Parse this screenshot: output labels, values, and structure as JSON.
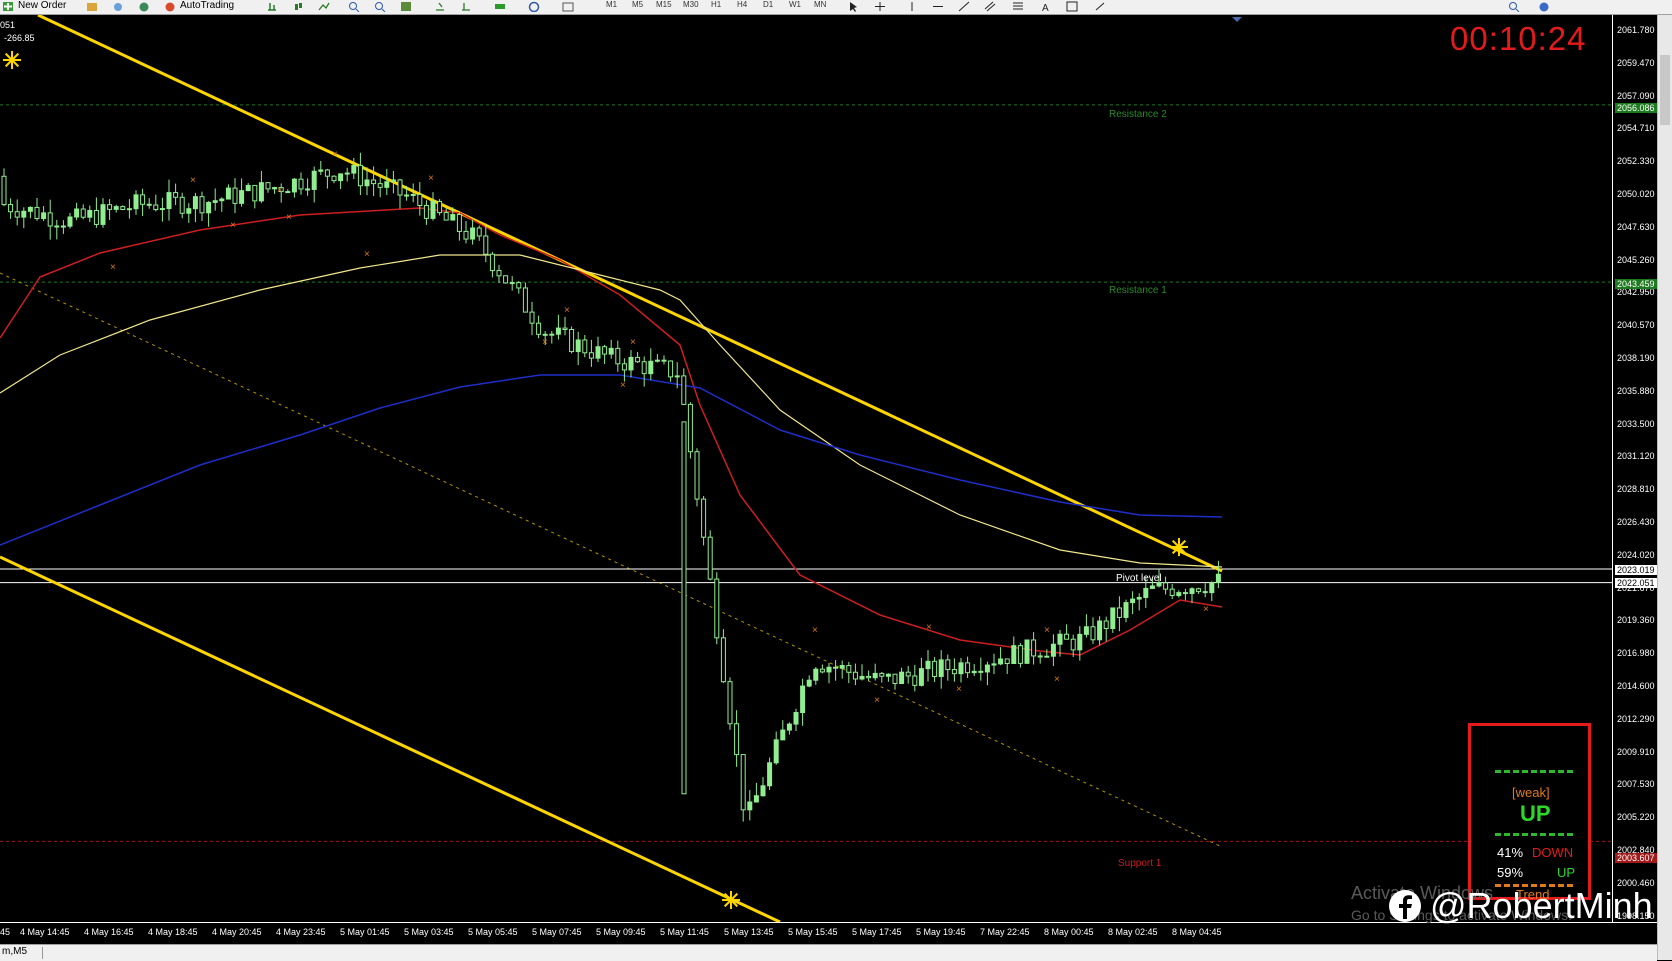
{
  "toolbar": {
    "new_order": "New Order",
    "autotrading": "AutoTrading",
    "timeframes": [
      "M1",
      "M5",
      "M15",
      "M30",
      "H1",
      "H4",
      "D1",
      "W1",
      "MN"
    ]
  },
  "chart_info": {
    "symbol_fragment": "051",
    "value_fragment": "-266.85",
    "timer": "00:10:24"
  },
  "price_axis": {
    "ticks": [
      "2061.780",
      "2059.470",
      "2057.090",
      "2054.710",
      "2052.330",
      "2050.020",
      "2047.630",
      "2045.260",
      "2042.950",
      "2040.570",
      "2038.190",
      "2035.880",
      "2033.500",
      "2031.120",
      "2028.810",
      "2026.430",
      "2024.020",
      "2021.670",
      "2019.360",
      "2016.980",
      "2014.600",
      "2012.290",
      "2009.910",
      "2007.530",
      "2005.220",
      "2002.840",
      "2000.460",
      "1998.150"
    ],
    "badges": {
      "resistance2": "2056.086",
      "resistance1": "2043.459",
      "current1": "2023.019",
      "current2": "2022.051",
      "support1": "2003.607"
    }
  },
  "levels": {
    "resistance2": "Resistance 2",
    "resistance1": "Resistance 1",
    "pivot": "Pivot level",
    "support1": "Support 1"
  },
  "time_axis": {
    "labels": [
      "45",
      "4 May 14:45",
      "4 May 16:45",
      "4 May 18:45",
      "4 May 20:45",
      "4 May 23:45",
      "5 May 01:45",
      "5 May 03:45",
      "5 May 05:45",
      "5 May 07:45",
      "5 May 09:45",
      "5 May 11:45",
      "5 May 13:45",
      "5 May 15:45",
      "5 May 17:45",
      "5 May 19:45",
      "7 May 22:45",
      "8 May 00:45",
      "8 May 02:45",
      "8 May 04:45"
    ]
  },
  "status_bar": {
    "tab": "m,M5"
  },
  "panel": {
    "strength": "[weak]",
    "direction": "UP",
    "down_pct": "41%",
    "down_label": "DOWN",
    "up_pct": "59%",
    "up_label": "UP",
    "trend": "Trend"
  },
  "watermark": {
    "line1": "Activate Windows",
    "line2": "Go to Settings to activate Windows.",
    "social": "@RobertMinh"
  },
  "colors": {
    "bull": "#90ee90",
    "trendline": "#ffd500",
    "ma_red": "#cc1f1f",
    "ma_khaki": "#f0e68c",
    "ma_blue": "#1e2ec8",
    "timer": "#e41b1b"
  },
  "chart_data": {
    "type": "line",
    "x": [
      "4 May 14:45",
      "4 May 16:45",
      "4 May 18:45",
      "4 May 20:45",
      "4 May 23:45",
      "5 May 01:45",
      "5 May 03:45",
      "5 May 05:45",
      "5 May 07:45",
      "5 May 09:45",
      "5 May 11:45",
      "5 May 13:45",
      "5 May 15:45",
      "5 May 17:45",
      "5 May 19:45",
      "7 May 22:45",
      "8 May 00:45",
      "8 May 02:45",
      "8 May 04:45"
    ],
    "series": [
      {
        "values": [
          2049.0,
          2047.8,
          2049.0,
          2049.2,
          2050.2,
          2051.5,
          2049.5,
          2046.5,
          2040.0,
          2038.0,
          2037.0,
          2005.0,
          2016.5,
          2015.0,
          2016.0,
          2017.0,
          2018.0,
          2021.5,
          2022.1
        ]
      }
    ],
    "ylim": [
      1998.15,
      2061.78
    ]
  }
}
